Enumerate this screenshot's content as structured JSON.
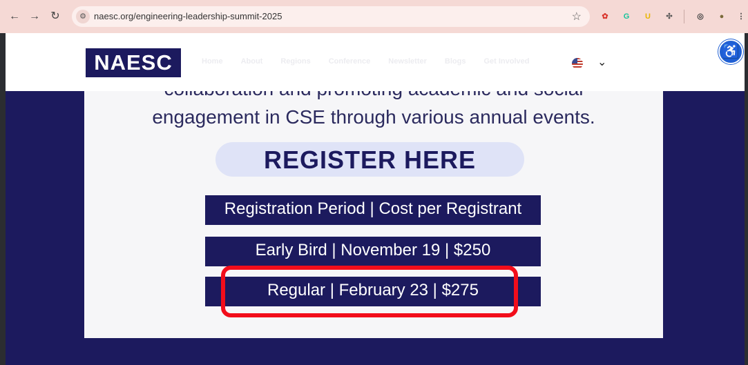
{
  "browser": {
    "nav": {
      "back": "←",
      "forward": "→",
      "reload": "↻"
    },
    "site_info_icon": "⚙",
    "url": "naesc.org/engineering-leadership-summit-2025",
    "bookmark_icon": "☆",
    "extensions": [
      {
        "name": "ext-red-icon",
        "glyph": "✿",
        "color": "#d9342b"
      },
      {
        "name": "grammarly-icon",
        "glyph": "G",
        "color": "#15c39a"
      },
      {
        "name": "ext-yellow-icon",
        "glyph": "U",
        "color": "#e8b500"
      },
      {
        "name": "puzzle-icon",
        "glyph": "✣",
        "color": "#555555"
      },
      {
        "name": "ext-swirl-icon",
        "glyph": "◎",
        "color": "#444444"
      },
      {
        "name": "profile-avatar-icon",
        "glyph": "●",
        "color": "#7a6a3a"
      }
    ],
    "menu_icon": "⋮"
  },
  "site": {
    "logo": "NAESC",
    "menu": [
      "Home",
      "About",
      "Regions",
      "Conference",
      "Newsletter",
      "Blogs",
      "Get Involved"
    ],
    "language_chevron": "⌄",
    "accessibility_icon": "♿"
  },
  "content": {
    "intro_cut": "collaboration and promoting academic and social",
    "intro": "engagement in CSE through various annual events.",
    "register_heading": "REGISTER HERE",
    "table_header": "Registration Period | Cost per Registrant",
    "rows": [
      "Early Bird | November 19 | $250",
      "Regular | February 23 | $275"
    ]
  },
  "colors": {
    "brand_navy": "#1c1a5e",
    "highlight_red": "#f20d1b",
    "pill_background": "#dfe3f7"
  }
}
